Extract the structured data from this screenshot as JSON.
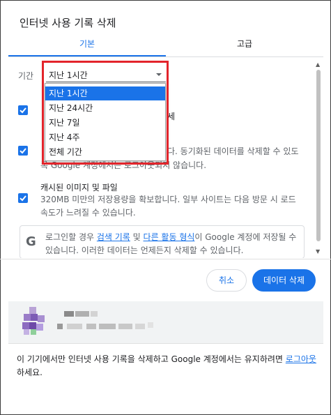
{
  "dialog": {
    "title": "인터넷 사용 기록 삭제"
  },
  "tabs": [
    {
      "label": "기본",
      "active": true
    },
    {
      "label": "고급",
      "active": false
    }
  ],
  "time_range": {
    "label": "기간",
    "selected": "지난 1시간",
    "options": [
      "지난 1시간",
      "지난 24시간",
      "지난 7일",
      "지난 4주",
      "전체 기간"
    ]
  },
  "items": {
    "history_partial": "세",
    "cookies_partial_line1": "다. 동기화된 데이터를 삭제할 수 있도",
    "cookies_partial_line2": "록 Google 계정에서는 로그아웃되지 않습니다.",
    "cache": {
      "title": "캐시된 이미지 및 파일",
      "desc": "320MB 미만의 저장용량을 확보합니다. 일부 사이트는 다음 방문 시 로드 속도가 느려질 수 있습니다."
    }
  },
  "notice": {
    "text_1": "로그인할 경우 ",
    "link_1": "검색 기록",
    "text_2": " 및 ",
    "link_2": "다른 활동 형식",
    "text_3": "이 Google 계정에 저장될 수 있습니다. 이러한 데이터는 언제든지 삭제할 수 있습니다."
  },
  "buttons": {
    "cancel": "취소",
    "delete": "데이터 삭제"
  },
  "footer": {
    "text": "이 기기에서만 인터넷 사용 기록을 삭제하고 Google 계정에서는 유지하려면 ",
    "link": "로그아웃",
    "suffix": "하세요."
  },
  "colors": {
    "accent": "#1a73e8",
    "highlight": "#e3242b"
  }
}
